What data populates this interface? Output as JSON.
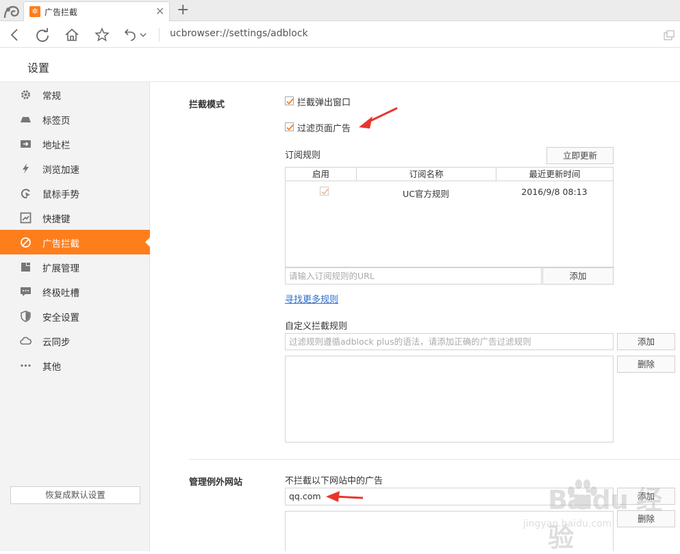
{
  "browser": {
    "tab_title": "广告拦截",
    "url": "ucbrowser://settings/adblock"
  },
  "header": {
    "title": "设置"
  },
  "sidebar": {
    "items": [
      {
        "label": "常规",
        "icon": "gear-icon"
      },
      {
        "label": "标签页",
        "icon": "tab-icon"
      },
      {
        "label": "地址栏",
        "icon": "address-bar-icon"
      },
      {
        "label": "浏览加速",
        "icon": "lightning-icon"
      },
      {
        "label": "鼠标手势",
        "icon": "mouse-gesture-icon"
      },
      {
        "label": "快捷键",
        "icon": "shortcut-icon"
      },
      {
        "label": "广告拦截",
        "icon": "block-icon",
        "active": true
      },
      {
        "label": "扩展管理",
        "icon": "extension-icon"
      },
      {
        "label": "终极吐槽",
        "icon": "comment-icon"
      },
      {
        "label": "安全设置",
        "icon": "shield-icon"
      },
      {
        "label": "云同步",
        "icon": "cloud-icon"
      },
      {
        "label": "其他",
        "icon": "more-icon"
      }
    ],
    "restore_label": "恢复成默认设置"
  },
  "adblock": {
    "mode_label": "拦截模式",
    "options": [
      {
        "label": "拦截弹出窗口",
        "checked": true
      },
      {
        "label": "过滤页面广告",
        "checked": true
      }
    ],
    "subscriptions": {
      "label": "订阅规则",
      "update_label": "立即更新",
      "columns": [
        "启用",
        "订阅名称",
        "最近更新时间"
      ],
      "rows": [
        {
          "enabled": true,
          "name": "UC官方规则",
          "updated": "2016/9/8 08:13"
        }
      ],
      "url_placeholder": "请输入订阅规则的URL",
      "add_label": "添加",
      "more_link": "寻找更多规则"
    },
    "custom": {
      "label": "自定义拦截规则",
      "placeholder": "过滤规则遵循adblock plus的语法，请添加正确的广告过滤规则",
      "add_label": "添加",
      "delete_label": "删除"
    },
    "exceptions": {
      "section_label": "管理例外网站",
      "label": "不拦截以下网站中的广告",
      "value": "qq.com",
      "add_label": "添加",
      "delete_label": "删除"
    }
  },
  "watermark": {
    "text": "Baidu 经验",
    "sub": "jingyan.baidu.com"
  },
  "colors": {
    "accent": "#ff7e1c",
    "link": "#2a6bc9",
    "arrow": "#e8362d"
  }
}
